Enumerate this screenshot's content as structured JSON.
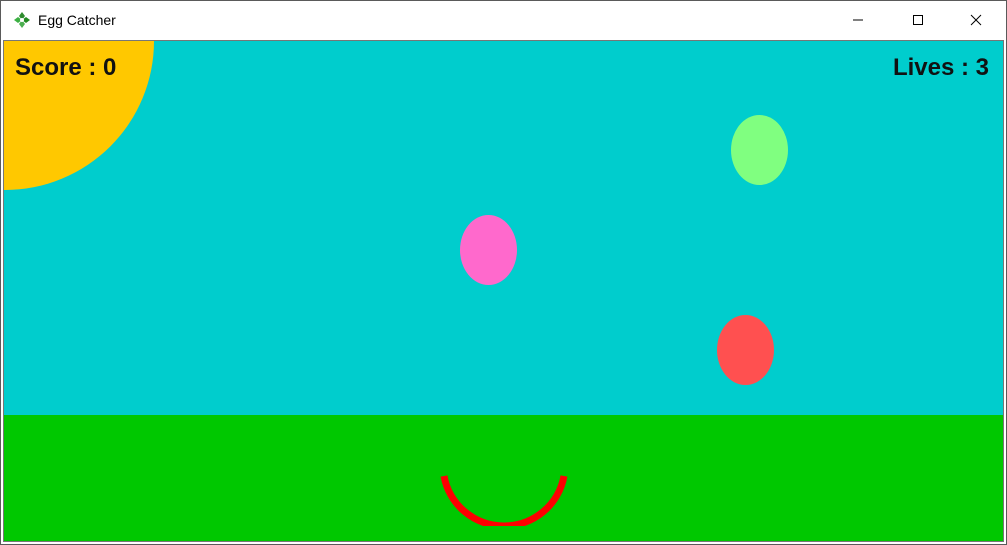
{
  "window": {
    "title": "Egg Catcher"
  },
  "hud": {
    "score_text": "Score : 0",
    "lives_text": "Lives : 3"
  },
  "scene": {
    "sky_color": "#00cdcd",
    "grass_color": "#00c800",
    "sun_color": "#ffc800",
    "catcher_color": "#ff0000"
  },
  "eggs": [
    {
      "name": "egg-green",
      "color": "#80ff80"
    },
    {
      "name": "egg-pink",
      "color": "#ff69cc"
    },
    {
      "name": "egg-red",
      "color": "#ff5050"
    }
  ],
  "icons": {
    "app": "egg-catcher-app-icon",
    "minimize": "minimize-icon",
    "maximize": "maximize-icon",
    "close": "close-icon"
  }
}
